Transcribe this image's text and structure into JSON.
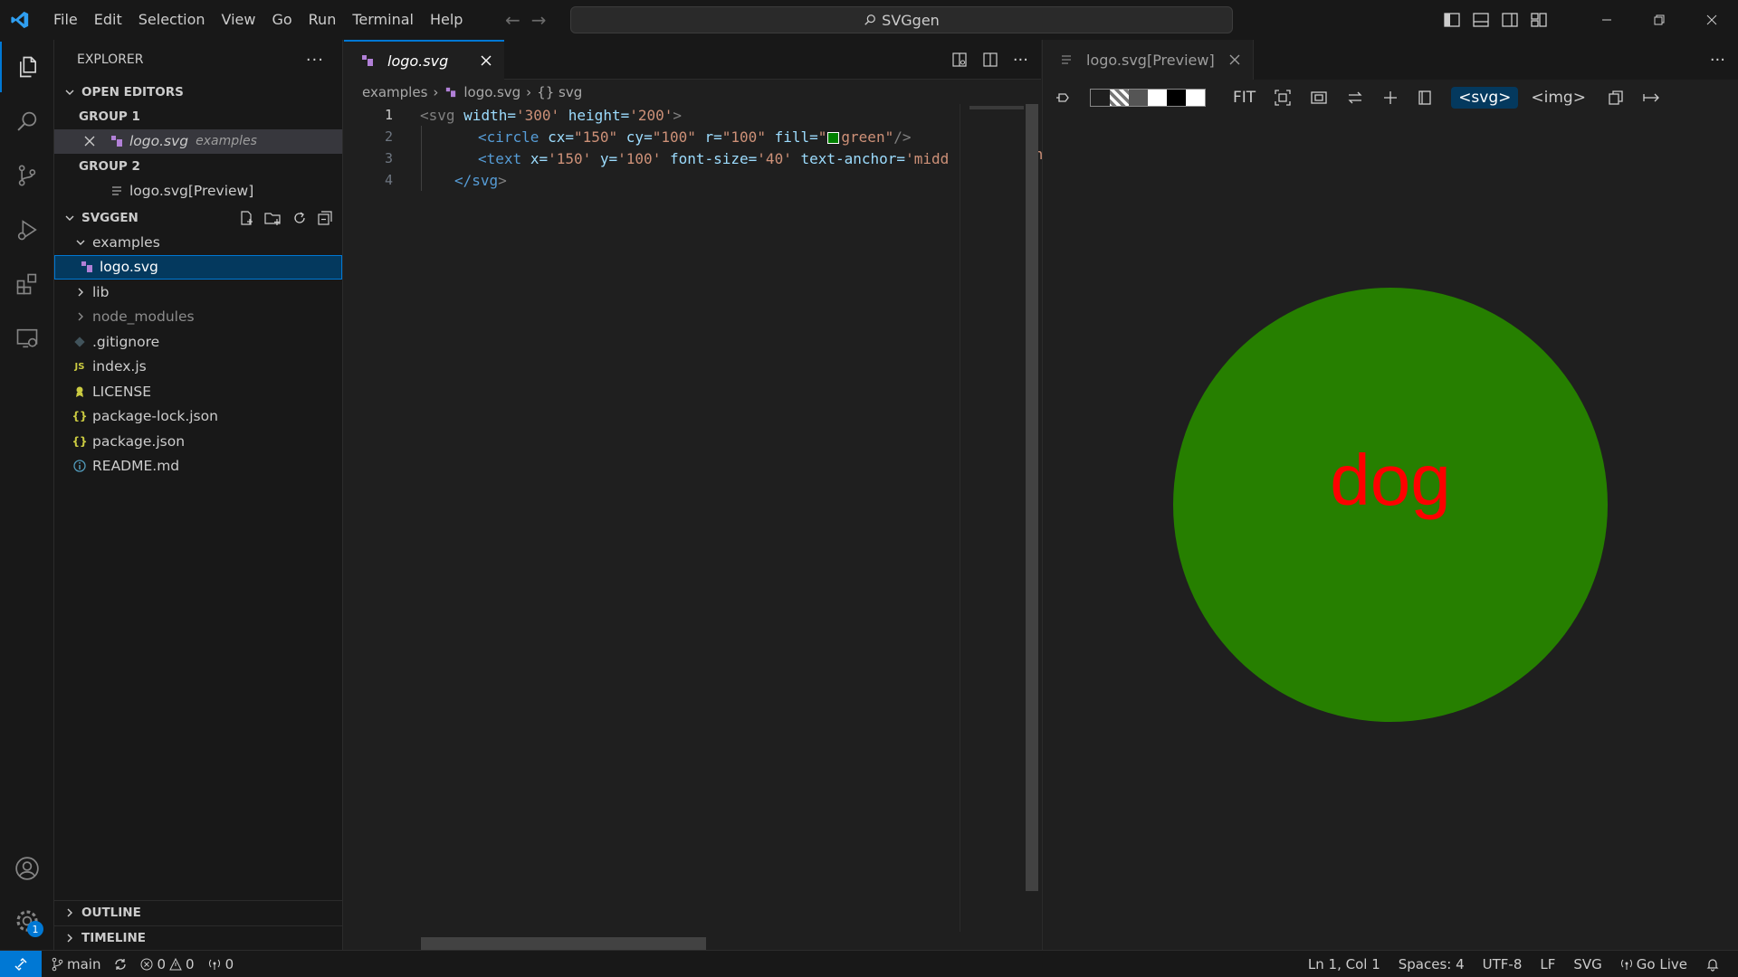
{
  "titlebar": {
    "menu": [
      "File",
      "Edit",
      "Selection",
      "View",
      "Go",
      "Run",
      "Terminal",
      "Help"
    ],
    "search_text": "SVGgen"
  },
  "sidebar": {
    "title": "EXPLORER",
    "open_editors": {
      "header": "OPEN EDITORS",
      "group1": "GROUP 1",
      "group1_file": "logo.svg",
      "group1_desc": "examples",
      "group2": "GROUP 2",
      "group2_file": "logo.svg[Preview]"
    },
    "project": {
      "header": "SVGGEN",
      "items": [
        {
          "label": "examples"
        },
        {
          "label": "logo.svg"
        },
        {
          "label": "lib"
        },
        {
          "label": "node_modules"
        },
        {
          "label": ".gitignore"
        },
        {
          "label": "index.js"
        },
        {
          "label": "LICENSE"
        },
        {
          "label": "package-lock.json"
        },
        {
          "label": "package.json"
        },
        {
          "label": "README.md"
        }
      ]
    },
    "outline": "OUTLINE",
    "timeline": "TIMELINE",
    "settings_badge": "1"
  },
  "editor": {
    "tab_label": "logo.svg",
    "breadcrumb": [
      "examples",
      "logo.svg",
      "{} svg"
    ],
    "line_numbers": [
      "1",
      "2",
      "3",
      "4"
    ],
    "lines": {
      "l1": {
        "open": "<svg",
        "a1": "width=",
        "v1": "'300'",
        "a2": "height=",
        "v2": "'200'",
        "close": ">"
      },
      "l2": {
        "open": "<circle",
        "a1": "cx=",
        "v1": "\"150\"",
        "a2": "cy=",
        "v2": "\"100\"",
        "a3": "r=",
        "v3": "\"100\"",
        "a4": "fill=",
        "v4q": "\"",
        "v4": "green\"",
        "close": "/>"
      },
      "l3": {
        "open": "<text",
        "a1": "x=",
        "v1": "'150'",
        "a2": "y=",
        "v2": "'100'",
        "a3": "font-size=",
        "v3": "'40'",
        "a4": "text-anchor=",
        "v4": "'midd",
        "tail": "gn"
      },
      "l4": {
        "open": "</svg",
        "close": ">"
      }
    },
    "fill_color": "#008000"
  },
  "preview": {
    "tab_label": "logo.svg[Preview]",
    "toolbar": {
      "fit": "FIT",
      "svg_btn": "<svg>",
      "img_btn": "<img>"
    },
    "svg": {
      "circle_fill": "#267f00",
      "text": "dog",
      "text_color": "#ff0000"
    }
  },
  "statusbar": {
    "branch": "main",
    "errors": "0",
    "warnings": "0",
    "ports": "0",
    "position": "Ln 1, Col 1",
    "spaces": "Spaces: 4",
    "encoding": "UTF-8",
    "eol": "LF",
    "language": "SVG",
    "golive": "Go Live"
  }
}
